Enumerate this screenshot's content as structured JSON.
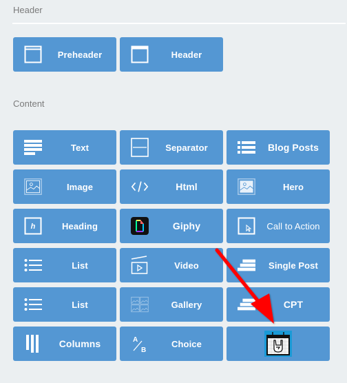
{
  "sections": {
    "header": {
      "title": "Header",
      "tiles": [
        {
          "label": "Preheader",
          "icon": "preheader-icon"
        },
        {
          "label": "Header",
          "icon": "header-icon"
        }
      ]
    },
    "content": {
      "title": "Content",
      "tiles": [
        {
          "label": "Text",
          "icon": "text-lines-icon"
        },
        {
          "label": "Separator",
          "icon": "separator-icon"
        },
        {
          "label": "Blog Posts",
          "icon": "list-icon"
        },
        {
          "label": "Image",
          "icon": "image-icon"
        },
        {
          "label": "Html",
          "icon": "code-icon"
        },
        {
          "label": "Hero",
          "icon": "hero-image-icon"
        },
        {
          "label": "Heading",
          "icon": "heading-icon"
        },
        {
          "label": "Giphy",
          "icon": "giphy-icon"
        },
        {
          "label": "Call to Action",
          "icon": "cursor-click-icon"
        },
        {
          "label": "List",
          "icon": "bullet-list-icon"
        },
        {
          "label": "Video",
          "icon": "video-icon"
        },
        {
          "label": "Single Post",
          "icon": "stack-lines-icon"
        },
        {
          "label": "List",
          "icon": "bullet-list-icon"
        },
        {
          "label": "Gallery",
          "icon": "gallery-icon"
        },
        {
          "label": "CPT",
          "icon": "stack-lines-icon"
        },
        {
          "label": "Columns",
          "icon": "columns-icon"
        },
        {
          "label": "Choice",
          "icon": "ab-choice-icon"
        },
        {
          "label": "",
          "icon": "rock-calendar-icon"
        }
      ]
    }
  },
  "annotation": {
    "type": "red-arrow",
    "color": "#ff0000",
    "points_to": "rock-calendar-tile"
  },
  "colors": {
    "tile": "#5497d3",
    "background": "#ebeff1",
    "text": "#ffffff"
  }
}
